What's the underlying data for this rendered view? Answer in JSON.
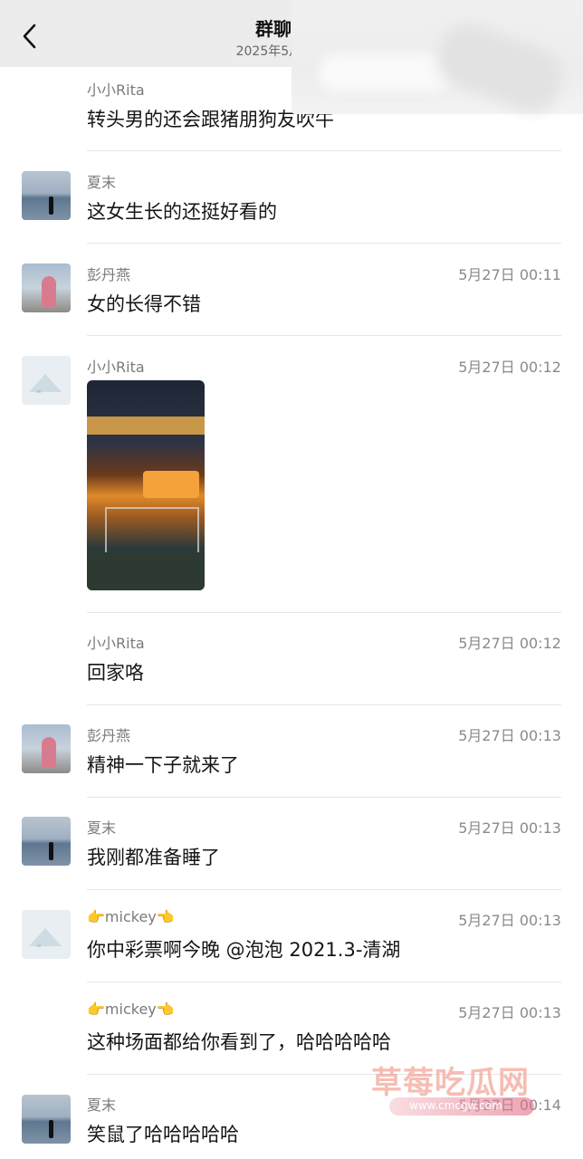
{
  "header": {
    "title": "群聊的聊",
    "subtitle": "2025年5月26日 至"
  },
  "messages": [
    {
      "name": "小小Rita",
      "time": "",
      "text": "转头男的还会跟猪朋狗友吹牛"
    },
    {
      "name": "夏末",
      "time": "",
      "text": "这女生长的还挺好看的"
    },
    {
      "name": "彭丹燕",
      "time": "5月27日 00:11",
      "text": "女的长得不错"
    },
    {
      "name": "小小Rita",
      "time": "5月27日 00:12",
      "text": ""
    },
    {
      "name": "小小Rita",
      "time": "5月27日 00:12",
      "text": "回家咯"
    },
    {
      "name": "彭丹燕",
      "time": "5月27日 00:13",
      "text": "精神一下子就来了"
    },
    {
      "name": "夏末",
      "time": "5月27日 00:13",
      "text": "我刚都准备睡了"
    },
    {
      "name": "👉mickey👈",
      "time": "5月27日 00:13",
      "text": "你中彩票啊今晚 @泡泡 2021.3-清湖"
    },
    {
      "name": "👉mickey👈",
      "time": "5月27日 00:13",
      "text": "这种场面都给你看到了，哈哈哈哈哈"
    },
    {
      "name": "夏末",
      "time": "5月27日 00:14",
      "text": "笑鼠了哈哈哈哈哈"
    }
  ],
  "watermark": {
    "brand": "草莓吃瓜网",
    "url": "www.cmcgw.com"
  },
  "icons": {
    "back": "chevron-left-icon"
  }
}
